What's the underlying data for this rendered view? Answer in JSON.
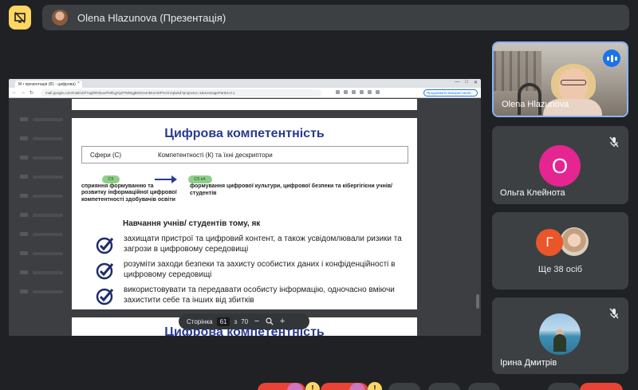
{
  "topbar": {
    "presenter_label": "Olena Hlazunova (Презентація)"
  },
  "browser": {
    "tab_title": "M • презентація (81 - цифрова)",
    "tab_close": "×",
    "url": "mail.google.com/mail/u/0/?ogbl#inbox/FMfcgzQZTMWgjBGDzxmkKzHDPXcGVqtwkd?projector=1&messagePartId=0.1",
    "continue_label": "Продовжити використання"
  },
  "slide": {
    "title": "Цифрова компетентність",
    "header_col1": "Сфери (С)",
    "header_col2": "Компетентності (К) та їхні дескриптори",
    "sphere_code": "С5",
    "competence_code": "С5 к4.",
    "left_desc": "сприяння формуванню та розвитку інформаційної цифрової компетентності здобувачів освіти",
    "right_desc": "формування цифрової культури, цифрової безпеки та кібергігієни учнів/студентів",
    "learning_title": "Навчання учнів/ студентів тому, як",
    "points": [
      "захищати пристрої та цифровий контент, а також усвідомлювали ризики та загрози в цифровому середовищі",
      "розуміти заходи безпеки та захисту особистих даних і конфіденційності в цифровому середовищі",
      "використовувати та передавати особисту інформацію, одночасно вміючи захистити себе та інших від збитків"
    ],
    "next_slide_title": "Цифрова компетентність"
  },
  "pdf_toolbar": {
    "page_label": "Сторінка",
    "current_page": "61",
    "of_label": "з",
    "total_pages": "70",
    "zoom_out": "−",
    "zoom_in": "+"
  },
  "participants": {
    "self_name": "Olena Hlazunova",
    "p2_initial": "О",
    "p2_name": "Ольга Клейнота",
    "more_initial": "Г",
    "more_label": "Ще 38 осіб",
    "p4_name": "Ірина Дмитрів"
  },
  "bottom": {
    "hand_badge_1": "!",
    "hand_badge_2": "!"
  },
  "colors": {
    "accent_yellow": "#fdd663",
    "slide_title_blue": "#2a3a8f",
    "pill_green": "#8ed08a",
    "avatar_pink": "#e52592",
    "avatar_orange": "#e8562a",
    "active_border": "#8ab4f8"
  },
  "icons": {
    "present_button": "stop-presenting-icon",
    "speaking_indicator": "audio-level-icon",
    "mic_off": "mic-off-icon",
    "check": "check-circle-icon"
  }
}
